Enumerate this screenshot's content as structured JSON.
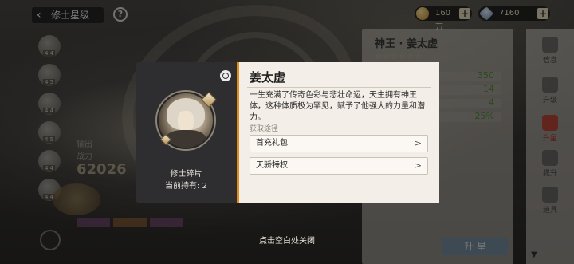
{
  "header": {
    "back_label": "修士星级",
    "help_symbol": "?"
  },
  "resources": {
    "spirit_stones": {
      "value": "160万",
      "icon": "coin-icon"
    },
    "jade": {
      "value": "7160",
      "icon": "jade-icon"
    },
    "plus_symbol": "+"
  },
  "roster_tags": [
    "4.4",
    "4.5",
    "4.4",
    "4.5",
    "4.4",
    "4.4"
  ],
  "left_stats": {
    "power_label": "战力",
    "power_value": "62026",
    "role": "输出"
  },
  "right_panel": {
    "title": "神王 · 姜太虚",
    "stars": "☆☆☆☆☆☆",
    "stat_values": [
      "350",
      "14",
      "4",
      "25%"
    ],
    "upgrade_label": "升 星"
  },
  "side_nav": [
    {
      "label": "信息",
      "icon": "info-icon",
      "active": false
    },
    {
      "label": "升级",
      "icon": "levelup-icon",
      "active": false
    },
    {
      "label": "升星",
      "icon": "star-icon",
      "active": true
    },
    {
      "label": "提升",
      "icon": "boost-icon",
      "active": false
    },
    {
      "label": "道具",
      "icon": "item-icon",
      "active": false
    }
  ],
  "modal": {
    "item_name": "修士碎片",
    "hold_label": "当前持有:",
    "hold_count": "2",
    "title": "姜太虚",
    "description": "一生充满了传奇色彩与悲壮命运，天生拥有神王体，这种体质极为罕见，赋予了他强大的力量和潜力。",
    "source_header": "获取途径",
    "sources": [
      {
        "label": "首充礼包",
        "arrow": ">"
      },
      {
        "label": "天骄特权",
        "arrow": ">"
      }
    ]
  },
  "close_hint": "点击空白处关闭",
  "colors": {
    "accent": "#e48c1e",
    "card_bg": "#f3efe8",
    "left_card_bg": "#2e2d30",
    "nav_active": "#b3261e"
  }
}
